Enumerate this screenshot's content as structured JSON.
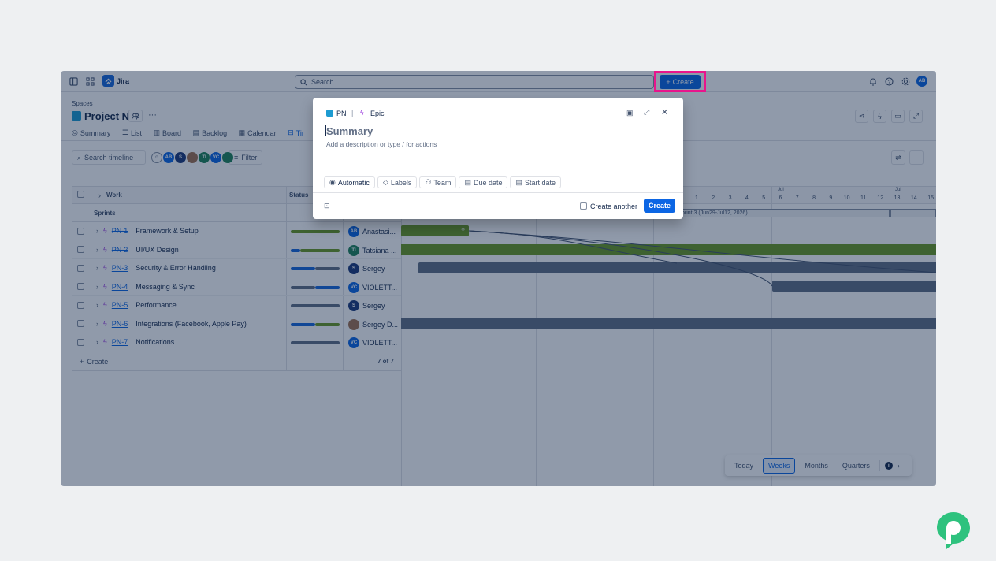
{
  "topbar": {
    "app_name": "Jira",
    "search_placeholder": "Search",
    "create_label": "Create",
    "user_initials": "AB"
  },
  "project": {
    "spaces_label": "Spaces",
    "name": "Project N"
  },
  "tabs": [
    {
      "label": "Summary",
      "icon": "globe-icon"
    },
    {
      "label": "List",
      "icon": "list-icon"
    },
    {
      "label": "Board",
      "icon": "board-icon"
    },
    {
      "label": "Backlog",
      "icon": "backlog-icon"
    },
    {
      "label": "Calendar",
      "icon": "calendar-icon"
    },
    {
      "label": "Tir",
      "icon": "timeline-icon"
    }
  ],
  "toolbar": {
    "search_timeline_placeholder": "Search timeline",
    "filter_label": "Filter",
    "avatars": [
      {
        "initials": "AB",
        "color": "#0c66e4"
      },
      {
        "initials": "S",
        "color": "#1d3a7a"
      },
      {
        "initials": "",
        "color": "#a07252"
      },
      {
        "initials": "TI",
        "color": "#1f845a"
      },
      {
        "initials": "VC",
        "color": "#0c66e4"
      },
      {
        "initials": "",
        "color": "#1f845a"
      }
    ]
  },
  "table": {
    "work_header": "Work",
    "status_header": "Status",
    "sprints_label": "Sprints",
    "rows": [
      {
        "key": "PN-1",
        "strike": true,
        "title": "Framework & Setup",
        "assignee": "Anastasi...",
        "av": "AB",
        "avcolor": "#0c66e4"
      },
      {
        "key": "PN-2",
        "strike": true,
        "title": "UI/UX Design",
        "assignee": "Tatsiana ...",
        "av": "TI",
        "avcolor": "#1f845a"
      },
      {
        "key": "PN-3",
        "strike": false,
        "title": "Security & Error Handling",
        "assignee": "Sergey",
        "av": "S",
        "avcolor": "#1d3a7a"
      },
      {
        "key": "PN-4",
        "strike": false,
        "title": "Messaging & Sync",
        "assignee": "VIOLETT...",
        "av": "VC",
        "avcolor": "#0c66e4"
      },
      {
        "key": "PN-5",
        "strike": false,
        "title": "Performance",
        "assignee": "Sergey",
        "av": "S",
        "avcolor": "#1d3a7a"
      },
      {
        "key": "PN-6",
        "strike": false,
        "title": "Integrations (Facebook, Apple Pay)",
        "assignee": "Sergey D...",
        "av": "",
        "avcolor": "#a07252"
      },
      {
        "key": "PN-7",
        "strike": false,
        "title": "Notifications",
        "assignee": "VIOLETT...",
        "av": "VC",
        "avcolor": "#0c66e4"
      }
    ],
    "create_label": "Create",
    "count_label": "7 of 7"
  },
  "timeline": {
    "month1": "Jul",
    "month2": "Jul",
    "days": [
      "1",
      "2",
      "3",
      "4",
      "5",
      "6",
      "7",
      "8",
      "9",
      "10",
      "11",
      "12",
      "13",
      "14",
      "15"
    ],
    "sprint_label": "Sprint 3 (Jun29-Jul12, 2026)"
  },
  "modal": {
    "project": "PN",
    "type": "Epic",
    "summary_placeholder": "Summary",
    "description_placeholder": "Add a description or type / for actions",
    "chips": [
      "Automatic",
      "Labels",
      "Team",
      "Due date",
      "Start date"
    ],
    "create_another_label": "Create another",
    "create_label": "Create"
  },
  "zoom": {
    "options": [
      "Today",
      "Weeks",
      "Months",
      "Quarters"
    ],
    "selected": "Weeks"
  },
  "colors": {
    "accent": "#0c66e4",
    "highlight": "#e8158c",
    "bar_green": "#6a9a23",
    "bar_gray": "#626f86"
  }
}
